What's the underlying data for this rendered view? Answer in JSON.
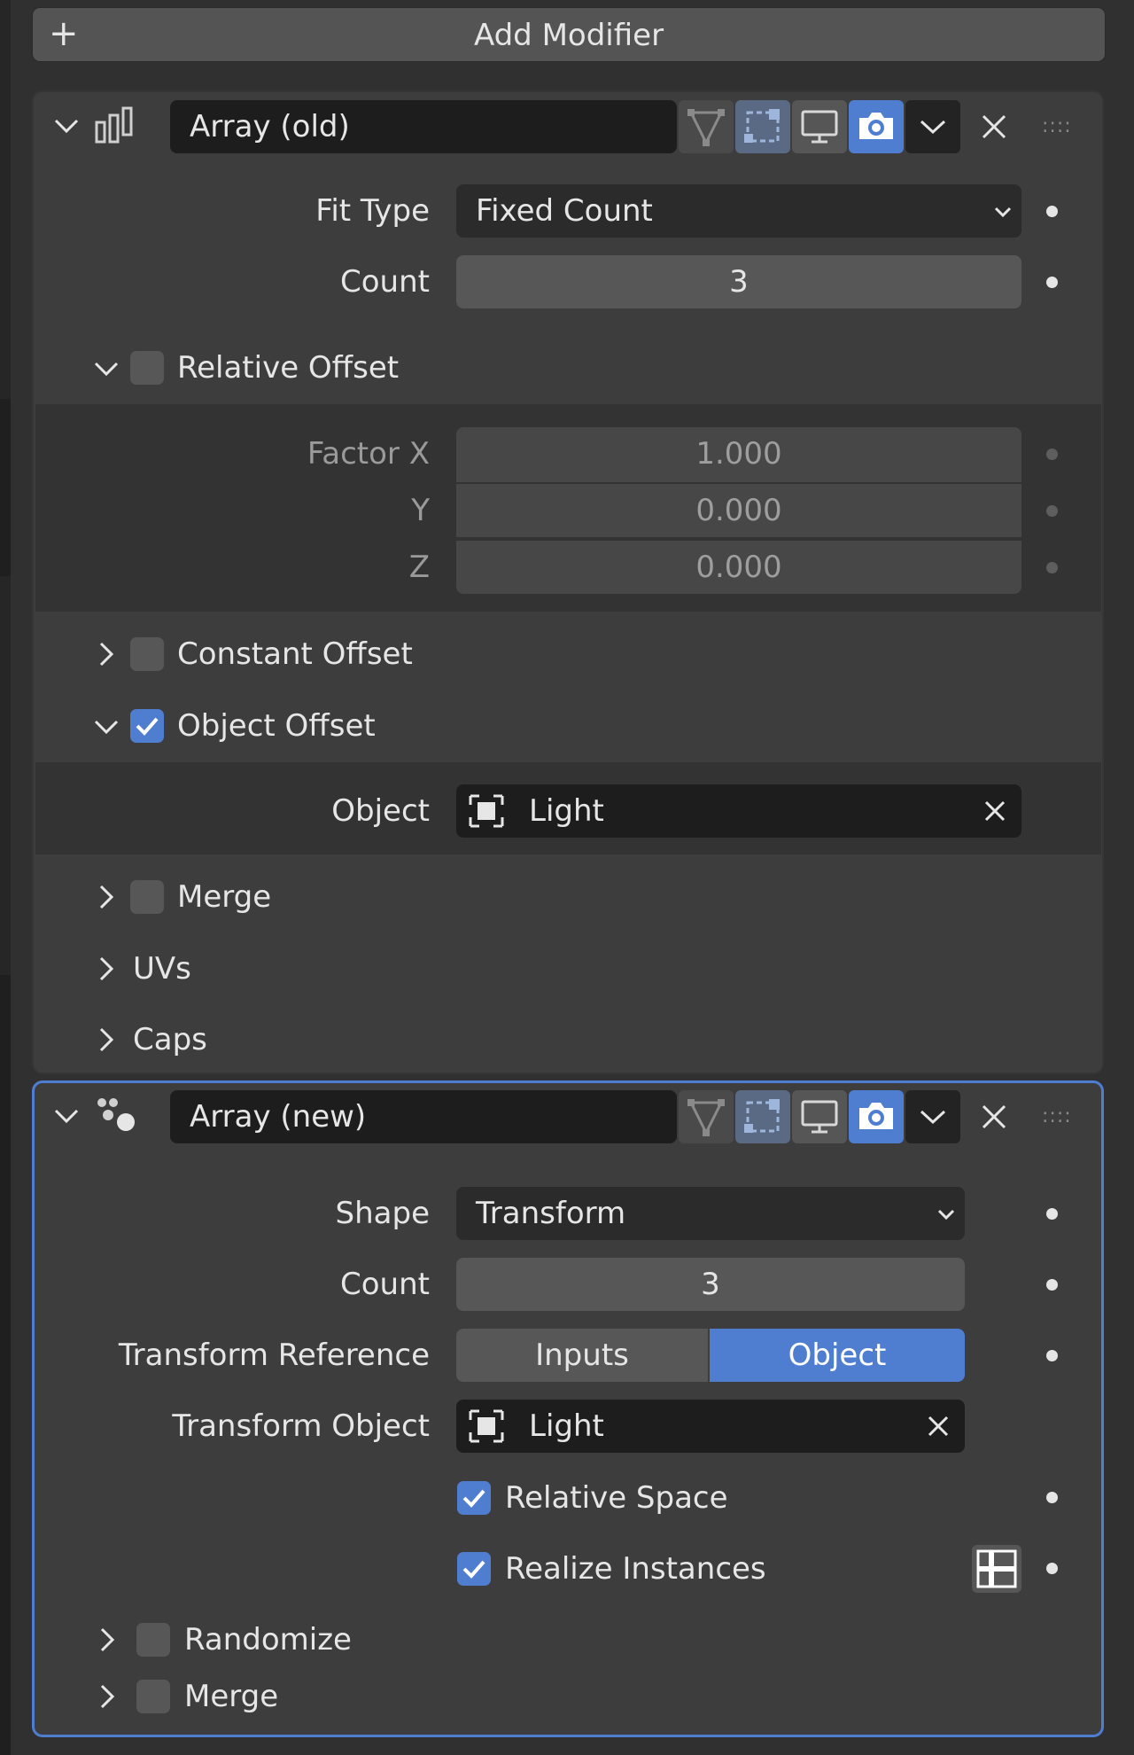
{
  "add_modifier": {
    "label": "Add Modifier"
  },
  "modifier_old": {
    "name": "Array (old)",
    "fit_type": {
      "label": "Fit Type",
      "value": "Fixed Count"
    },
    "count": {
      "label": "Count",
      "value": "3"
    },
    "relative_offset": {
      "label": "Relative Offset",
      "enabled": false,
      "factor_x": {
        "label": "Factor X",
        "value": "1.000"
      },
      "y": {
        "label": "Y",
        "value": "0.000"
      },
      "z": {
        "label": "Z",
        "value": "0.000"
      }
    },
    "constant_offset": {
      "label": "Constant Offset",
      "enabled": false
    },
    "object_offset": {
      "label": "Object Offset",
      "enabled": true,
      "object": {
        "label": "Object",
        "value": "Light"
      }
    },
    "merge": {
      "label": "Merge"
    },
    "uvs": {
      "label": "UVs"
    },
    "caps": {
      "label": "Caps"
    }
  },
  "modifier_new": {
    "name": "Array (new)",
    "shape": {
      "label": "Shape",
      "value": "Transform"
    },
    "count": {
      "label": "Count",
      "value": "3"
    },
    "transform_reference": {
      "label": "Transform Reference",
      "options": [
        "Inputs",
        "Object"
      ],
      "selected": "Object"
    },
    "transform_object": {
      "label": "Transform Object",
      "value": "Light"
    },
    "relative_space": {
      "label": "Relative Space",
      "checked": true
    },
    "realize_instances": {
      "label": "Realize Instances",
      "checked": true
    },
    "randomize": {
      "label": "Randomize"
    },
    "merge": {
      "label": "Merge"
    }
  },
  "colors": {
    "panel": "#3d3d3d",
    "field": "#575757",
    "dark_field": "#1d1d1d",
    "accent": "#4f7ed1",
    "background": "#303030"
  }
}
